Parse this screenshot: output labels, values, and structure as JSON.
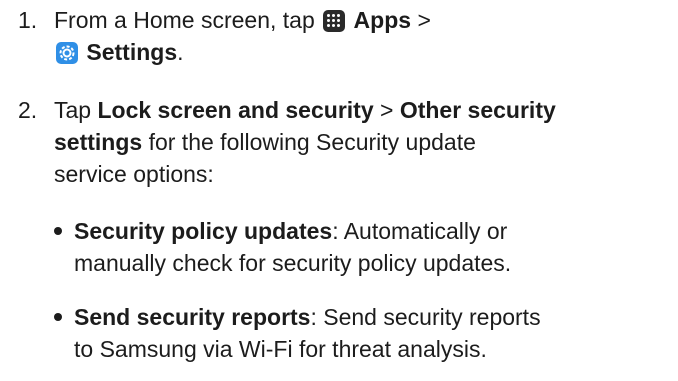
{
  "step1": {
    "number": "1.",
    "line1_prefix": "From a Home screen, tap",
    "apps_label": "Apps",
    "sep": ">",
    "settings_label": "Settings",
    "settings_suffix": ".",
    "icons": [
      "apps-icon",
      "settings-icon"
    ]
  },
  "step2": {
    "number": "2.",
    "tap": "Tap",
    "lock_screen": "Lock screen and security",
    "sep": ">",
    "other_security_1": "Other security",
    "other_security_2": "settings",
    "rest_line2": "for the following Security update",
    "line3": "service options:"
  },
  "bullets": [
    {
      "title": "Security policy updates",
      "line1_rest": ": Automatically or",
      "line2": "manually check for security policy updates."
    },
    {
      "title": "Send security reports",
      "line1_rest": ": Send security reports",
      "line2": "to Samsung via Wi-Fi for threat analysis."
    }
  ],
  "colors": {
    "text": "#1c1c1c",
    "apps_icon_bg": "#2a2a2a",
    "settings_icon_bg": "#2f8fe6"
  }
}
